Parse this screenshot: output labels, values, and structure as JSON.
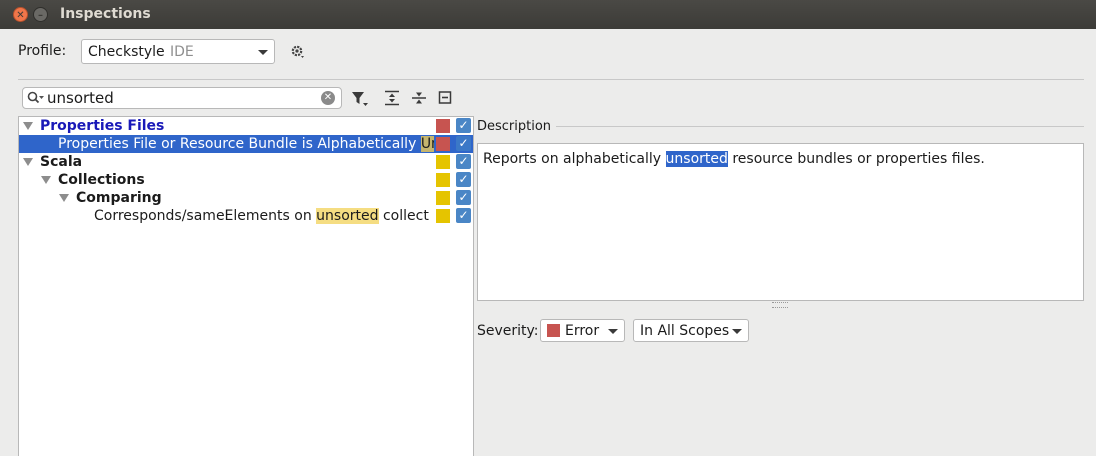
{
  "window": {
    "title": "Inspections"
  },
  "profile": {
    "label": "Profile:",
    "name": "Checkstyle",
    "scope": "IDE"
  },
  "search": {
    "value": "unsorted"
  },
  "tree": {
    "rows": [
      {
        "label": "Properties Files"
      },
      {
        "label_pre": "Properties File or Resource Bundle is Alphabetically ",
        "label_hl": "Un"
      },
      {
        "label": "Scala"
      },
      {
        "label": "Collections"
      },
      {
        "label": "Comparing"
      },
      {
        "label_pre": "Corresponds/sameElements on ",
        "label_hl": "unsorted",
        "label_post": " collect"
      }
    ]
  },
  "description": {
    "heading": "Description",
    "text_pre": "Reports on alphabetically ",
    "text_hl": "unsorted",
    "text_post": " resource bundles or properties files."
  },
  "severity": {
    "label": "Severity:",
    "value": "Error",
    "scope": "In All Scopes"
  },
  "colors": {
    "error": "#c75450",
    "warning": "#e5c400",
    "selection": "#2f65ca",
    "checkbox": "#4a86c6"
  }
}
